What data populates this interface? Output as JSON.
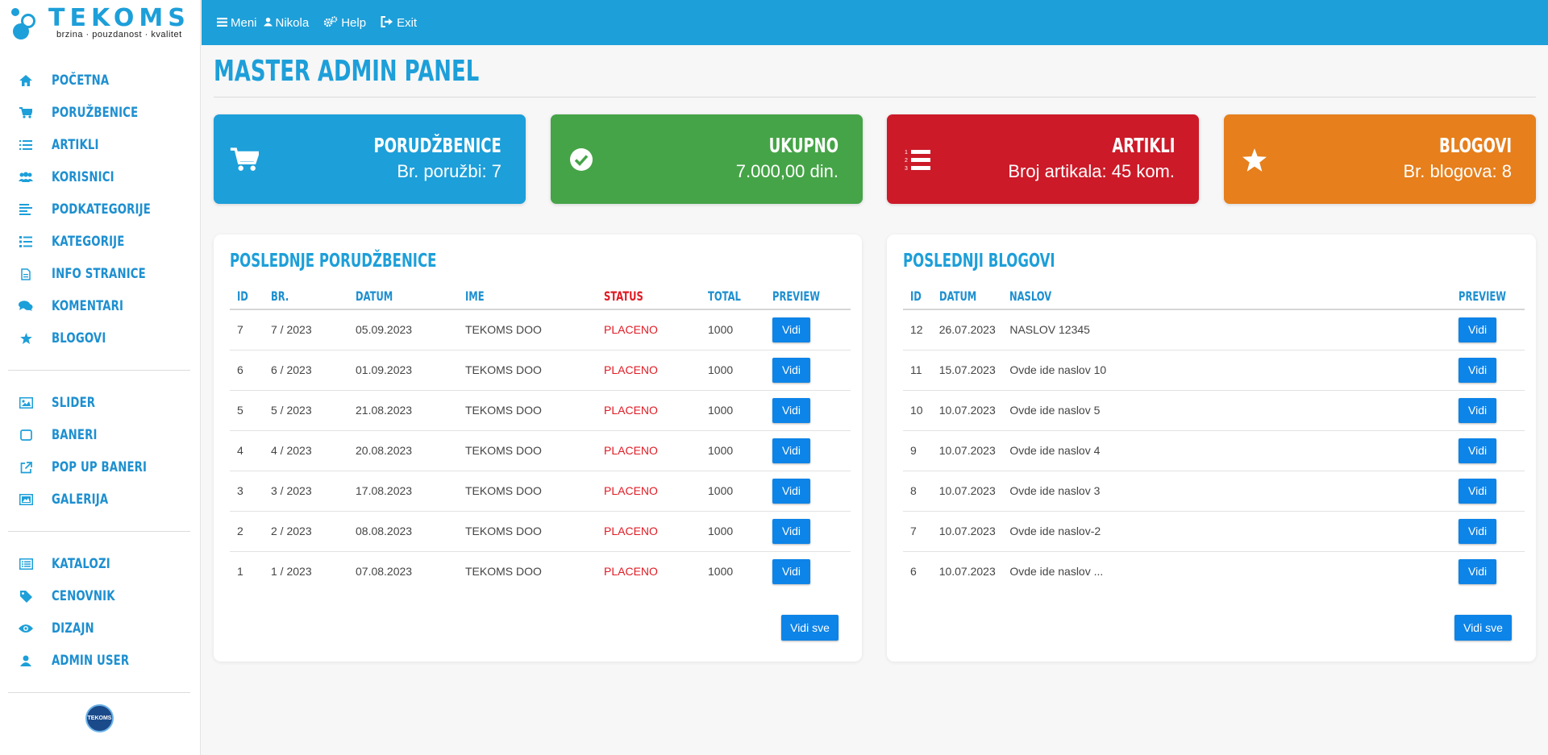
{
  "brand": {
    "name": "TEKOMS",
    "tagline": "brzina · pouzdanost · kvalitet",
    "badge": "TEKOMS"
  },
  "topbar": {
    "items": [
      {
        "label": "Meni",
        "icon": "menu-icon"
      },
      {
        "label": "Nikola",
        "icon": "user-icon"
      },
      {
        "label": "Help",
        "icon": "gears-icon"
      },
      {
        "label": "Exit",
        "icon": "exit-icon"
      }
    ]
  },
  "sidebar": {
    "group1": [
      {
        "label": "POČETNA",
        "icon": "home-icon"
      },
      {
        "label": "PORUŽBENICE",
        "icon": "cart-icon"
      },
      {
        "label": "ARTIKLI",
        "icon": "list-ordered-icon"
      },
      {
        "label": "KORISNICI",
        "icon": "users-icon"
      },
      {
        "label": "PODKATEGORIJE",
        "icon": "align-left-icon"
      },
      {
        "label": "KATEGORIJE",
        "icon": "list-icon"
      },
      {
        "label": "INFO STRANICE",
        "icon": "file-icon"
      },
      {
        "label": "KOMENTARI",
        "icon": "comments-icon"
      },
      {
        "label": "BLOGOVI",
        "icon": "star-icon"
      }
    ],
    "group2": [
      {
        "label": "SLIDER",
        "icon": "image-icon"
      },
      {
        "label": "BANERI",
        "icon": "square-icon"
      },
      {
        "label": "POP UP BANERI",
        "icon": "external-link-icon"
      },
      {
        "label": "GALERIJA",
        "icon": "gallery-icon"
      }
    ],
    "group3": [
      {
        "label": "KATALOZI",
        "icon": "catalog-icon"
      },
      {
        "label": "CENOVNIK",
        "icon": "tag-icon"
      },
      {
        "label": "DIZAJN",
        "icon": "eye-icon"
      },
      {
        "label": "ADMIN USER",
        "icon": "user-icon"
      }
    ]
  },
  "page": {
    "title": "MASTER ADMIN PANEL"
  },
  "stats": [
    {
      "title": "PORUDŽBENICE",
      "value": "Br. poružbi: 7",
      "color": "#1d9fd9",
      "icon": "cart-icon"
    },
    {
      "title": "UKUPNO",
      "value": "7.000,00 din.",
      "color": "#45a447",
      "icon": "check-circle-icon"
    },
    {
      "title": "ARTIKLI",
      "value": "Broj artikala: 45 kom.",
      "color": "#cc1a28",
      "icon": "list-ordered-icon"
    },
    {
      "title": "BLOGOVI",
      "value": "Br. blogova: 8",
      "color": "#e67f1c",
      "icon": "star-icon"
    }
  ],
  "orders": {
    "title": "POSLEDNJE PORUDŽBENICE",
    "headers": [
      "ID",
      "BR.",
      "DATUM",
      "IME",
      "STATUS",
      "TOTAL",
      "PREVIEW"
    ],
    "rows": [
      {
        "id": "7",
        "br": "7 / 2023",
        "datum": "05.09.2023",
        "ime": "TEKOMS DOO",
        "status": "PLACENO",
        "total": "1000",
        "action": "Vidi"
      },
      {
        "id": "6",
        "br": "6 / 2023",
        "datum": "01.09.2023",
        "ime": "TEKOMS DOO",
        "status": "PLACENO",
        "total": "1000",
        "action": "Vidi"
      },
      {
        "id": "5",
        "br": "5 / 2023",
        "datum": "21.08.2023",
        "ime": "TEKOMS DOO",
        "status": "PLACENO",
        "total": "1000",
        "action": "Vidi"
      },
      {
        "id": "4",
        "br": "4 / 2023",
        "datum": "20.08.2023",
        "ime": "TEKOMS DOO",
        "status": "PLACENO",
        "total": "1000",
        "action": "Vidi"
      },
      {
        "id": "3",
        "br": "3 / 2023",
        "datum": "17.08.2023",
        "ime": "TEKOMS DOO",
        "status": "PLACENO",
        "total": "1000",
        "action": "Vidi"
      },
      {
        "id": "2",
        "br": "2 / 2023",
        "datum": "08.08.2023",
        "ime": "TEKOMS DOO",
        "status": "PLACENO",
        "total": "1000",
        "action": "Vidi"
      },
      {
        "id": "1",
        "br": "1 / 2023",
        "datum": "07.08.2023",
        "ime": "TEKOMS DOO",
        "status": "PLACENO",
        "total": "1000",
        "action": "Vidi"
      }
    ],
    "view_all": "Vidi sve"
  },
  "blogs": {
    "title": "POSLEDNJI BLOGOVI",
    "headers": [
      "ID",
      "DATUM",
      "NASLOV",
      "PREVIEW"
    ],
    "rows": [
      {
        "id": "12",
        "datum": "26.07.2023",
        "naslov": "NASLOV 12345",
        "action": "Vidi"
      },
      {
        "id": "11",
        "datum": "15.07.2023",
        "naslov": "Ovde ide naslov 10",
        "action": "Vidi"
      },
      {
        "id": "10",
        "datum": "10.07.2023",
        "naslov": "Ovde ide naslov 5",
        "action": "Vidi"
      },
      {
        "id": "9",
        "datum": "10.07.2023",
        "naslov": "Ovde ide naslov 4",
        "action": "Vidi"
      },
      {
        "id": "8",
        "datum": "10.07.2023",
        "naslov": "Ovde ide naslov 3",
        "action": "Vidi"
      },
      {
        "id": "7",
        "datum": "10.07.2023",
        "naslov": "Ovde ide naslov-2",
        "action": "Vidi"
      },
      {
        "id": "6",
        "datum": "10.07.2023",
        "naslov": "Ovde ide naslov ...",
        "action": "Vidi"
      }
    ],
    "view_all": "Vidi sve"
  }
}
